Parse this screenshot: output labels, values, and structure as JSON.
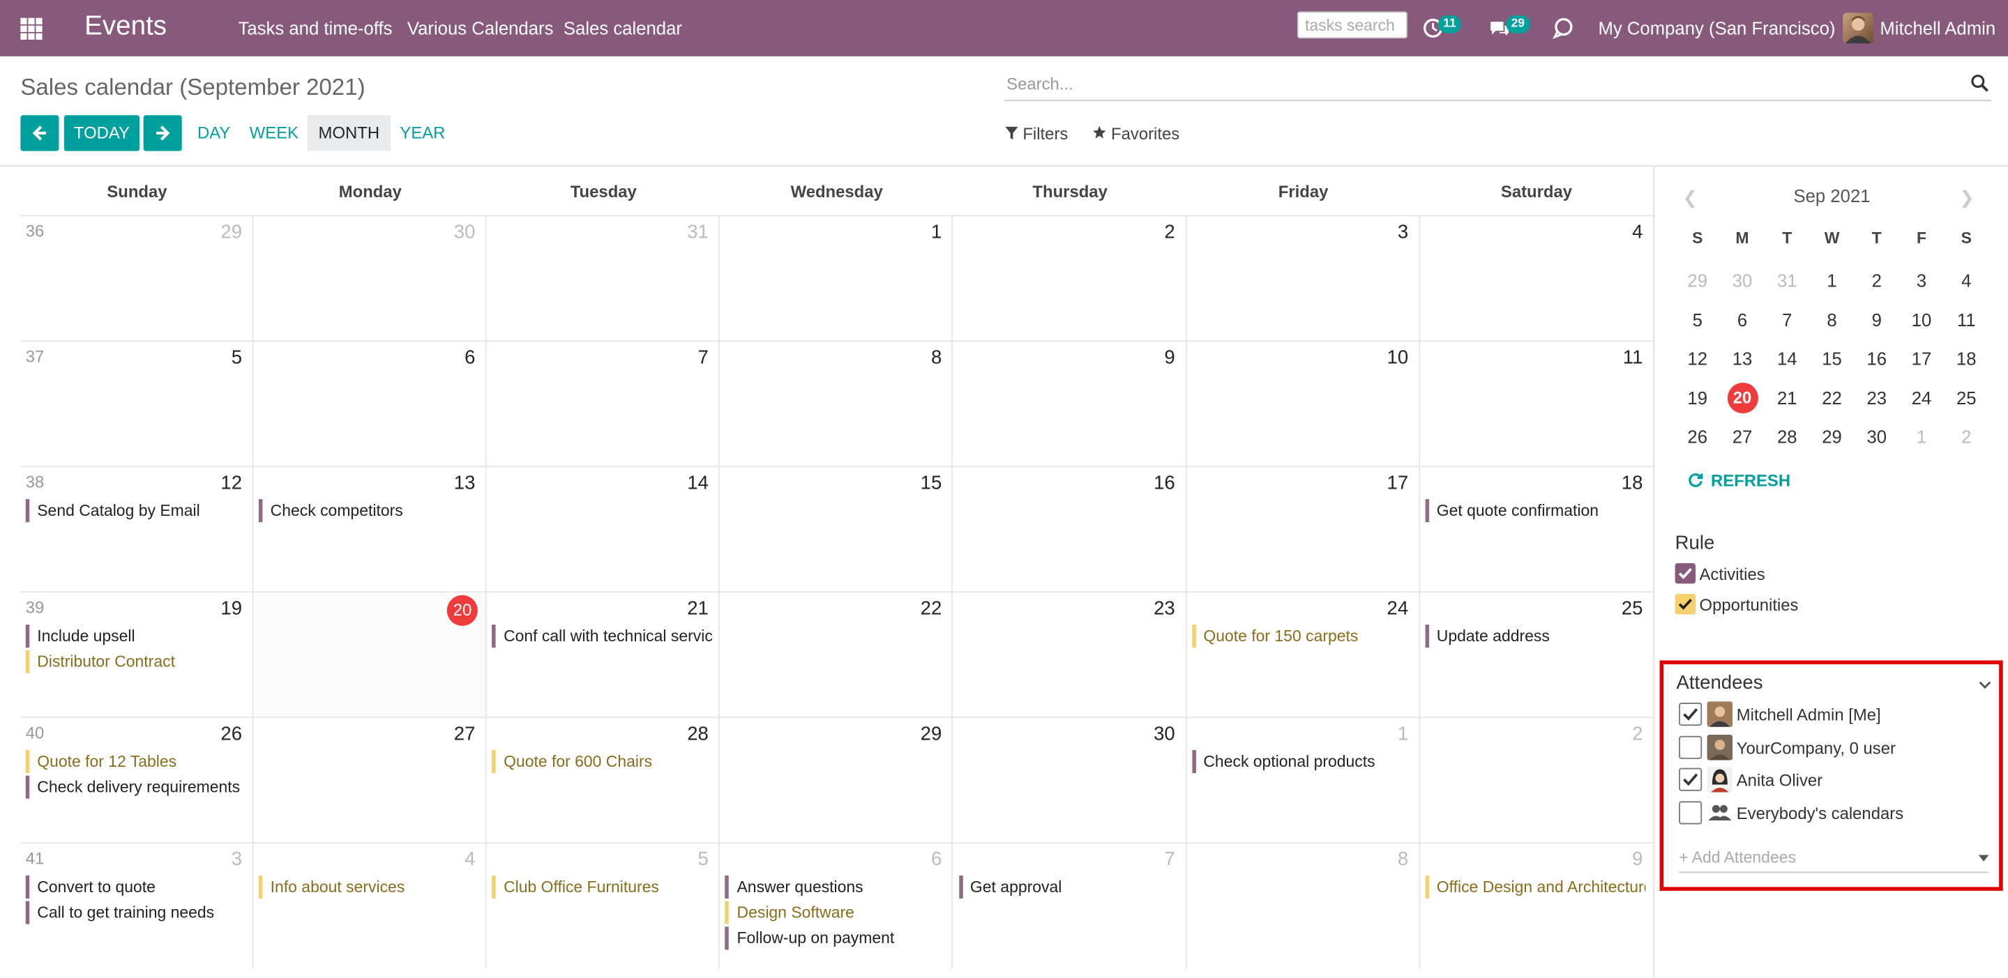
{
  "navbar": {
    "brand": "Events",
    "menu": [
      "Tasks and time-offs",
      "Various Calendars",
      "Sales calendar"
    ],
    "search_placeholder": "tasks search",
    "activity_count": "11",
    "messages_count": "29",
    "company": "My Company (San Francisco)",
    "user": "Mitchell Admin",
    "icons": [
      "apps-grid-icon",
      "clock-icon",
      "chat-icon",
      "discuss-icon"
    ]
  },
  "control_panel": {
    "breadcrumb": "Sales calendar (September 2021)",
    "search_placeholder": "Search...",
    "today_label": "TODAY",
    "scales": [
      "DAY",
      "WEEK",
      "MONTH",
      "YEAR"
    ],
    "active_scale": "MONTH",
    "filters_label": "Filters",
    "favorites_label": "Favorites"
  },
  "calendar": {
    "day_headers": [
      "Sunday",
      "Monday",
      "Tuesday",
      "Wednesday",
      "Thursday",
      "Friday",
      "Saturday"
    ],
    "weeks": [
      {
        "week": "36",
        "days": [
          {
            "day": "29",
            "muted": true,
            "events": []
          },
          {
            "day": "30",
            "muted": true,
            "events": []
          },
          {
            "day": "31",
            "muted": true,
            "events": []
          },
          {
            "day": "1",
            "events": []
          },
          {
            "day": "2",
            "events": []
          },
          {
            "day": "3",
            "events": []
          },
          {
            "day": "4",
            "events": []
          }
        ]
      },
      {
        "week": "37",
        "days": [
          {
            "day": "5",
            "events": []
          },
          {
            "day": "6",
            "events": []
          },
          {
            "day": "7",
            "events": []
          },
          {
            "day": "8",
            "events": []
          },
          {
            "day": "9",
            "events": []
          },
          {
            "day": "10",
            "events": []
          },
          {
            "day": "11",
            "events": []
          }
        ]
      },
      {
        "week": "38",
        "days": [
          {
            "day": "12",
            "events": [
              {
                "title": "Send Catalog by Email",
                "kind": "activity"
              }
            ]
          },
          {
            "day": "13",
            "events": [
              {
                "title": "Check competitors",
                "kind": "activity"
              }
            ]
          },
          {
            "day": "14",
            "events": []
          },
          {
            "day": "15",
            "events": []
          },
          {
            "day": "16",
            "events": []
          },
          {
            "day": "17",
            "events": []
          },
          {
            "day": "18",
            "events": [
              {
                "title": "Get quote confirmation",
                "kind": "activity"
              }
            ]
          }
        ]
      },
      {
        "week": "39",
        "days": [
          {
            "day": "19",
            "events": [
              {
                "title": "Include upsell",
                "kind": "activity"
              },
              {
                "title": "Distributor Contract",
                "kind": "opportunity"
              }
            ]
          },
          {
            "day": "20",
            "today": true,
            "events": []
          },
          {
            "day": "21",
            "events": [
              {
                "title": "Conf call with technical service",
                "kind": "activity"
              }
            ]
          },
          {
            "day": "22",
            "events": []
          },
          {
            "day": "23",
            "events": []
          },
          {
            "day": "24",
            "events": [
              {
                "title": "Quote for 150 carpets",
                "kind": "opportunity"
              }
            ]
          },
          {
            "day": "25",
            "events": [
              {
                "title": "Update address",
                "kind": "activity"
              }
            ]
          }
        ]
      },
      {
        "week": "40",
        "days": [
          {
            "day": "26",
            "events": [
              {
                "title": "Quote for 12 Tables",
                "kind": "opportunity"
              },
              {
                "title": "Check delivery requirements",
                "kind": "activity"
              }
            ]
          },
          {
            "day": "27",
            "events": []
          },
          {
            "day": "28",
            "events": [
              {
                "title": "Quote for 600 Chairs",
                "kind": "opportunity"
              }
            ]
          },
          {
            "day": "29",
            "events": []
          },
          {
            "day": "30",
            "events": []
          },
          {
            "day": "1",
            "muted": true,
            "events": [
              {
                "title": "Check optional products",
                "kind": "activity"
              }
            ]
          },
          {
            "day": "2",
            "muted": true,
            "events": []
          }
        ]
      },
      {
        "week": "41",
        "days": [
          {
            "day": "3",
            "muted": true,
            "events": [
              {
                "title": "Convert to quote",
                "kind": "activity"
              },
              {
                "title": "Call to get training needs",
                "kind": "activity"
              }
            ]
          },
          {
            "day": "4",
            "muted": true,
            "events": [
              {
                "title": "Info about services",
                "kind": "opportunity"
              }
            ]
          },
          {
            "day": "5",
            "muted": true,
            "events": [
              {
                "title": "Club Office Furnitures",
                "kind": "opportunity"
              }
            ]
          },
          {
            "day": "6",
            "muted": true,
            "events": [
              {
                "title": "Answer questions",
                "kind": "activity"
              },
              {
                "title": "Design Software",
                "kind": "opportunity"
              },
              {
                "title": "Follow-up on payment",
                "kind": "activity"
              }
            ]
          },
          {
            "day": "7",
            "muted": true,
            "events": [
              {
                "title": "Get approval",
                "kind": "activity"
              }
            ]
          },
          {
            "day": "8",
            "muted": true,
            "events": []
          },
          {
            "day": "9",
            "muted": true,
            "events": [
              {
                "title": "Office Design and Architecture",
                "kind": "opportunity"
              }
            ]
          }
        ]
      }
    ]
  },
  "sidebar": {
    "mini_title": "Sep 2021",
    "dow": [
      "S",
      "M",
      "T",
      "W",
      "T",
      "F",
      "S"
    ],
    "weeks": [
      [
        {
          "d": "29",
          "m": true
        },
        {
          "d": "30",
          "m": true
        },
        {
          "d": "31",
          "m": true
        },
        {
          "d": "1"
        },
        {
          "d": "2"
        },
        {
          "d": "3"
        },
        {
          "d": "4"
        }
      ],
      [
        {
          "d": "5"
        },
        {
          "d": "6"
        },
        {
          "d": "7"
        },
        {
          "d": "8"
        },
        {
          "d": "9"
        },
        {
          "d": "10"
        },
        {
          "d": "11"
        }
      ],
      [
        {
          "d": "12"
        },
        {
          "d": "13"
        },
        {
          "d": "14"
        },
        {
          "d": "15"
        },
        {
          "d": "16"
        },
        {
          "d": "17"
        },
        {
          "d": "18"
        }
      ],
      [
        {
          "d": "19"
        },
        {
          "d": "20",
          "t": true
        },
        {
          "d": "21"
        },
        {
          "d": "22"
        },
        {
          "d": "23"
        },
        {
          "d": "24"
        },
        {
          "d": "25"
        }
      ],
      [
        {
          "d": "26"
        },
        {
          "d": "27"
        },
        {
          "d": "28"
        },
        {
          "d": "29"
        },
        {
          "d": "30"
        },
        {
          "d": "1",
          "m": true
        },
        {
          "d": "2",
          "m": true
        }
      ]
    ],
    "refresh_label": "REFRESH",
    "rule_title": "Rule",
    "rules": [
      {
        "label": "Activities",
        "checked": true,
        "color": "#875a7b"
      },
      {
        "label": "Opportunities",
        "checked": true,
        "color": "#f5d06c"
      }
    ],
    "attendees_title": "Attendees",
    "attendees": [
      {
        "label": "Mitchell Admin [Me]",
        "checked": true,
        "avatar": "man"
      },
      {
        "label": "YourCompany, 0 user",
        "checked": false,
        "avatar": "man2"
      },
      {
        "label": "Anita Oliver",
        "checked": true,
        "avatar": "woman"
      },
      {
        "label": "Everybody's calendars",
        "checked": false,
        "avatar": "group"
      }
    ],
    "add_attendees_placeholder": "+ Add Attendees"
  },
  "colors": {
    "brand": "#875a7b",
    "accent": "#00a09d",
    "today": "#ef3b3b",
    "opportunity": "#f5d06c",
    "highlight": "#e00000"
  }
}
